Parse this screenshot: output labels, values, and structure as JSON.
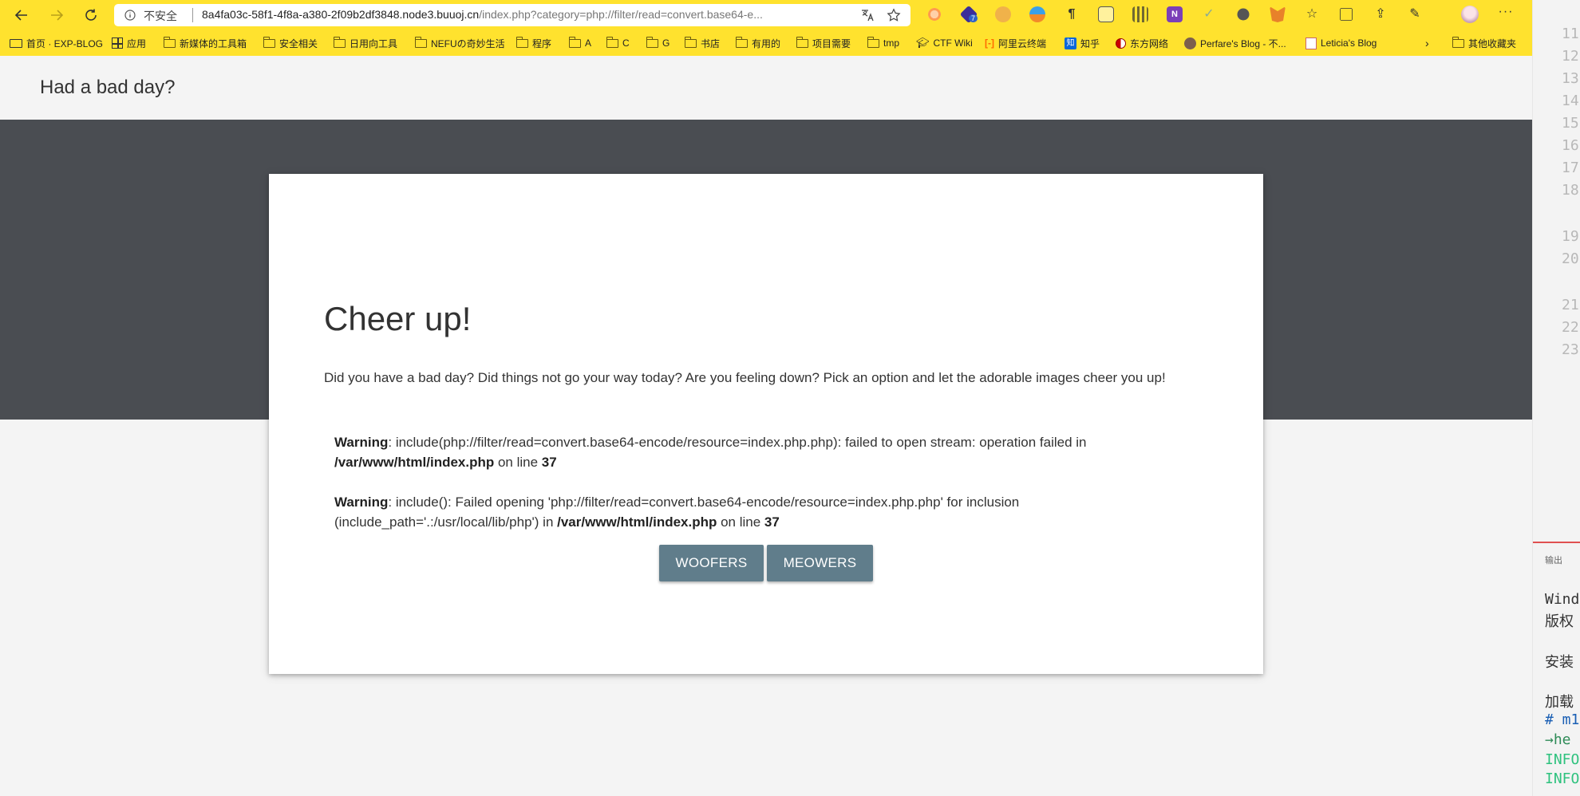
{
  "browser": {
    "insecure_label": "不安全",
    "url_host": "8a4fa03c-58f1-4f8a-a380-2f09b2df3848.node3.buuoj.cn",
    "url_path": "/index.php?category=php://filter/read=convert.base64-e...",
    "bookmarks": [
      {
        "label": "首页 · EXP-BLOG",
        "icon": "book-icon"
      },
      {
        "label": "应用",
        "icon": "apps-grid-icon"
      },
      {
        "label": "新媒体的工具箱",
        "icon": "folder-icon"
      },
      {
        "label": "安全相关",
        "icon": "folder-icon"
      },
      {
        "label": "日用向工具",
        "icon": "folder-icon"
      },
      {
        "label": "NEFUの奇妙生活",
        "icon": "folder-icon"
      },
      {
        "label": "程序",
        "icon": "folder-icon"
      },
      {
        "label": "A",
        "icon": "folder-icon"
      },
      {
        "label": "C",
        "icon": "folder-icon"
      },
      {
        "label": "G",
        "icon": "folder-icon"
      },
      {
        "label": "书店",
        "icon": "folder-icon"
      },
      {
        "label": "有用的",
        "icon": "folder-icon"
      },
      {
        "label": "项目需要",
        "icon": "folder-icon"
      },
      {
        "label": "tmp",
        "icon": "folder-icon"
      },
      {
        "label": "CTF Wiki",
        "icon": "graduation-cap-icon"
      },
      {
        "label": "阿里云终端",
        "icon": "aliyun-icon"
      },
      {
        "label": "知乎",
        "icon": "zhihu-icon"
      },
      {
        "label": "东方网络",
        "icon": "yin-yang-icon"
      },
      {
        "label": "Perfare's Blog - 不...",
        "icon": "avatar-icon"
      },
      {
        "label": "Leticia's Blog",
        "icon": "blog-icon"
      }
    ],
    "other_bookmarks": "其他收藏夹",
    "extension_badge": "7"
  },
  "page": {
    "site_title": "Had a bad day?",
    "card_title": "Cheer up!",
    "card_description": "Did you have a bad day? Did things not go your way today? Are you feeling down? Pick an option and let the adorable images cheer you up!",
    "warnings": [
      {
        "label": "Warning",
        "message": ": include(php://filter/read=convert.base64-encode/resource=index.php.php): failed to open stream: operation failed in ",
        "file": "/var/www/html/index.php",
        "on_line": " on line ",
        "line": "37"
      },
      {
        "label": "Warning",
        "message": ": include(): Failed opening 'php://filter/read=convert.base64-encode/resource=index.php.php' for inclusion (include_path='.:/usr/local/lib/php') in ",
        "file": "/var/www/html/index.php",
        "on_line": " on line ",
        "line": "37"
      }
    ],
    "buttons": {
      "woofers": "WOOFERS",
      "meowers": "MEOWERS"
    }
  },
  "side_panel": {
    "line_numbers": [
      "11",
      "12",
      "13",
      "14",
      "15",
      "16",
      "17",
      "18",
      "19",
      "20",
      "21",
      "22",
      "23"
    ],
    "output_label": "输出",
    "terminal_lines": [
      {
        "text": "Wind",
        "color": "#333333"
      },
      {
        "text": "版权",
        "color": "#333333"
      },
      {
        "text": "安装",
        "color": "#333333"
      },
      {
        "text": "加载",
        "color": "#333333"
      },
      {
        "text": "# m1",
        "color": "#1a5fb4"
      },
      {
        "text": "→he",
        "color": "#1a5fb4"
      },
      {
        "text": "INFO",
        "color": "#2ec27e"
      },
      {
        "text": "INFO",
        "color": "#2ec27e"
      }
    ]
  },
  "colors": {
    "chrome_yellow": "#ffe22e",
    "hero_band": "#4a4d52",
    "button": "#607d8b"
  }
}
